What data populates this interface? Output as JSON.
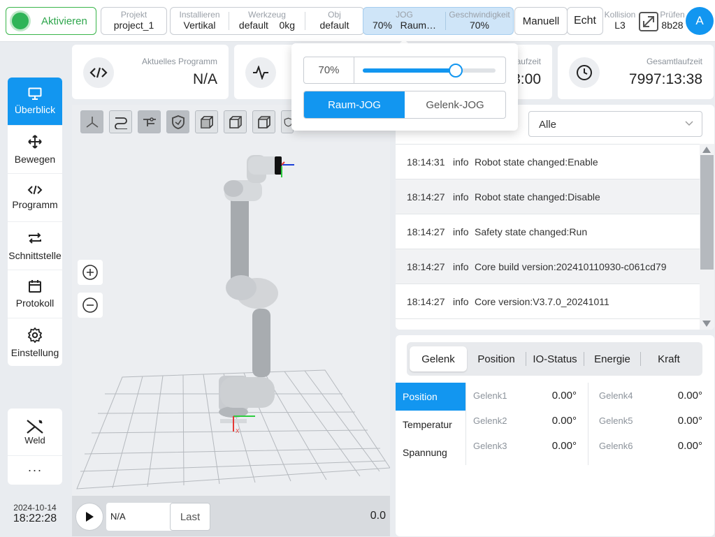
{
  "topbar": {
    "activate_label": "Aktivieren",
    "projekt": {
      "caption": "Projekt",
      "value": "project_1"
    },
    "installieren": {
      "caption": "Installieren",
      "value": "Vertikal"
    },
    "werkzeug": {
      "caption": "Werkzeug",
      "name": "default",
      "mass": "0kg"
    },
    "obj": {
      "caption": "Obj",
      "value": "default"
    },
    "jog": {
      "caption": "JOG",
      "percent": "70%",
      "mode": "Raum…"
    },
    "geschwindigkeit": {
      "caption": "Geschwindigkeit",
      "value": "70%"
    },
    "manuell_label": "Manuell",
    "echt_label": "Echt",
    "kollision": {
      "caption": "Kollision",
      "value": "L3"
    },
    "pruefen": {
      "caption": "Prüfen",
      "value": "8b28"
    },
    "avatar_letter": "A"
  },
  "sidebar": {
    "items": [
      {
        "label": "Überblick",
        "icon": "monitor-icon",
        "active": true
      },
      {
        "label": "Bewegen",
        "icon": "move-icon"
      },
      {
        "label": "Programm",
        "icon": "code-icon"
      },
      {
        "label": "Schnittstelle",
        "icon": "swap-icon"
      },
      {
        "label": "Protokoll",
        "icon": "calendar-icon"
      },
      {
        "label": "Einstellung",
        "icon": "gear-icon"
      }
    ],
    "weld_label": "Weld",
    "more_label": "···"
  },
  "datetime": {
    "date": "2024-10-14",
    "time": "18:22:28"
  },
  "cards": {
    "program": {
      "caption": "Aktuelles Programm",
      "value": "N/A"
    },
    "laufzeit": {
      "caption": "laufzeit",
      "value": "3:00"
    },
    "gesamt": {
      "caption": "Gesamtlaufzeit",
      "value": "7997:13:38"
    }
  },
  "view3d": {
    "program_field": "N/A",
    "last_label": "Last",
    "value": "0.0",
    "axis_label": "X"
  },
  "log": {
    "filter_label": ":",
    "filter_value": "Alle",
    "entries": [
      {
        "time": "18:14:31",
        "level": "info",
        "message": "Robot state changed:Enable"
      },
      {
        "time": "18:14:27",
        "level": "info",
        "message": "Robot state changed:Disable"
      },
      {
        "time": "18:14:27",
        "level": "info",
        "message": "Safety state changed:Run"
      },
      {
        "time": "18:14:27",
        "level": "info",
        "message": "Core build version:202410110930-c061cd79"
      },
      {
        "time": "18:14:27",
        "level": "info",
        "message": "Core version:V3.7.0_20241011"
      }
    ]
  },
  "joint_panel": {
    "tabs": [
      "Gelenk",
      "Position",
      "IO-Status",
      "Energie",
      "Kraft"
    ],
    "active_tab": "Gelenk",
    "submenu": [
      "Position",
      "Temperatur",
      "Spannung"
    ],
    "joints": [
      {
        "name": "Gelenk1",
        "value": "0.00°"
      },
      {
        "name": "Gelenk2",
        "value": "0.00°"
      },
      {
        "name": "Gelenk3",
        "value": "0.00°"
      },
      {
        "name": "Gelenk4",
        "value": "0.00°"
      },
      {
        "name": "Gelenk5",
        "value": "0.00°"
      },
      {
        "name": "Gelenk6",
        "value": "0.00°"
      }
    ]
  },
  "jog_popover": {
    "percent_label": "70%",
    "slider_value": 0.7,
    "mode_space": "Raum-JOG",
    "mode_joint": "Gelenk-JOG",
    "active_mode": "Raum-JOG"
  },
  "colors": {
    "accent": "#1296f0",
    "active_green": "#2fb457",
    "jog_bg": "#cfe5f8"
  }
}
